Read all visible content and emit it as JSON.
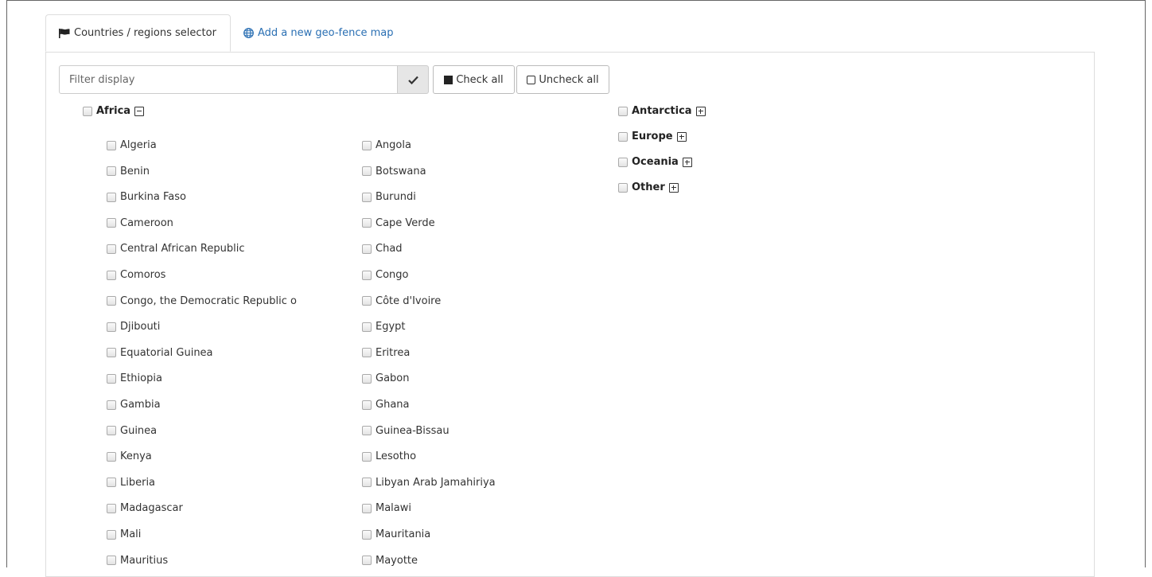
{
  "tabs": {
    "active_label": "Countries / regions selector",
    "link_label": "Add a new geo-fence map"
  },
  "filter": {
    "placeholder": "Filter display",
    "check_all_label": "Check all",
    "uncheck_all_label": "Uncheck all"
  },
  "regions": {
    "africa": "Africa",
    "antarctica": "Antarctica",
    "europe": "Europe",
    "oceania": "Oceania",
    "other": "Other"
  },
  "africa_countries": [
    [
      "Algeria",
      "Angola"
    ],
    [
      "Benin",
      "Botswana"
    ],
    [
      "Burkina Faso",
      "Burundi"
    ],
    [
      "Cameroon",
      "Cape Verde"
    ],
    [
      "Central African Republic",
      "Chad"
    ],
    [
      "Comoros",
      "Congo"
    ],
    [
      "Congo, the Democratic Republic o",
      "Côte d'Ivoire"
    ],
    [
      "Djibouti",
      "Egypt"
    ],
    [
      "Equatorial Guinea",
      "Eritrea"
    ],
    [
      "Ethiopia",
      "Gabon"
    ],
    [
      "Gambia",
      "Ghana"
    ],
    [
      "Guinea",
      "Guinea-Bissau"
    ],
    [
      "Kenya",
      "Lesotho"
    ],
    [
      "Liberia",
      "Libyan Arab Jamahiriya"
    ],
    [
      "Madagascar",
      "Malawi"
    ],
    [
      "Mali",
      "Mauritania"
    ],
    [
      "Mauritius",
      "Mayotte"
    ]
  ]
}
